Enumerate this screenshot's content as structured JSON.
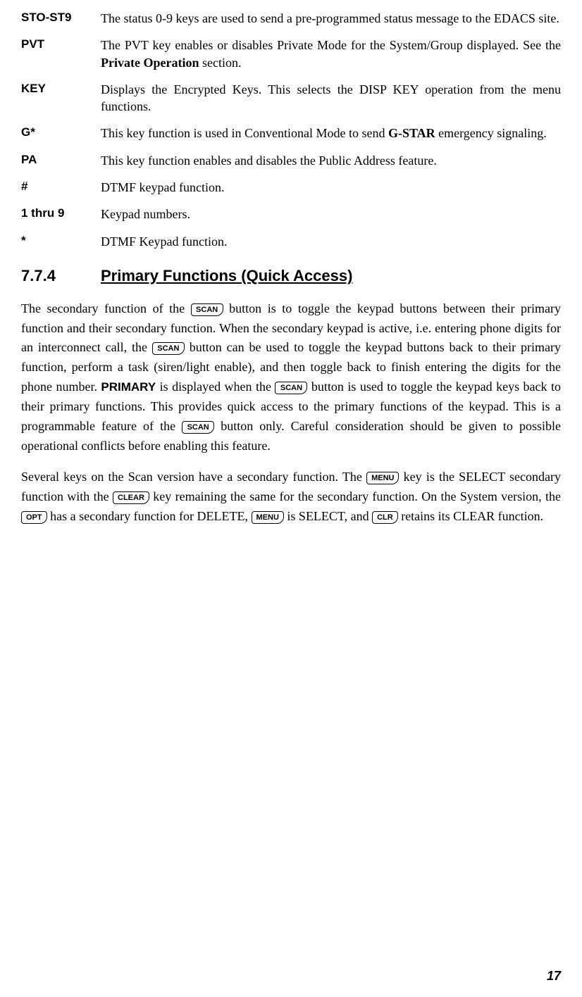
{
  "definitions": [
    {
      "term": "STO-ST9",
      "desc": "The status 0-9 keys are used to send a pre-programmed status message to the EDACS site."
    },
    {
      "term": "PVT",
      "desc_pre": "The PVT key enables or disables Private Mode for the System/Group displayed. See the ",
      "bold": "Private Operation",
      "desc_post": " section."
    },
    {
      "term": "KEY",
      "desc": "Displays the Encrypted Keys. This selects the DISP KEY operation from the menu functions."
    },
    {
      "term": "G*",
      "desc_pre": "This key function is used in Conventional Mode to send ",
      "bold": "G-STAR",
      "desc_post": " emergency signaling."
    },
    {
      "term": "PA",
      "desc": "This key function enables and disables the Public Address feature."
    },
    {
      "term": "#",
      "desc": "DTMF keypad function."
    },
    {
      "term": "1 thru 9",
      "desc": "Keypad numbers."
    },
    {
      "term": "*",
      "desc": "DTMF Keypad function."
    }
  ],
  "section": {
    "number": "7.7.4",
    "title": "Primary Functions (Quick Access)"
  },
  "keys": {
    "scan": "SCAN",
    "menu": "MENU",
    "clear": "CLEAR",
    "opt": "OPT",
    "clr": "CLR"
  },
  "para1": {
    "t1": "The secondary function of the ",
    "t2": " button is to toggle the keypad buttons between their primary function and their secondary function. When the secondary keypad is active, i.e. entering phone digits for an interconnect call, the ",
    "t3": " button can be used to toggle the keypad buttons back to their primary function, perform a task (siren/light enable), and then toggle back to finish entering the digits for the phone number.  ",
    "primary": "PRIMARY",
    "t4": " is displayed when the ",
    "t5": " button is used to toggle the keypad keys back to their primary functions.  This provides quick access to the primary functions of the keypad.  This is a programmable feature of the ",
    "t6": " button only. Careful consideration should be given to possible operational conflicts before enabling this feature."
  },
  "para2": {
    "t1": "Several keys on the Scan version have a secondary function.  The ",
    "t2": " key is the SELECT secondary function with the ",
    "t3": "  key remaining the same for the secondary function.  On the System version, the ",
    "t4": " has a secondary function for DELETE, ",
    "t5": " is SELECT, and ",
    "t6": " retains its CLEAR function."
  },
  "pageNumber": "17"
}
